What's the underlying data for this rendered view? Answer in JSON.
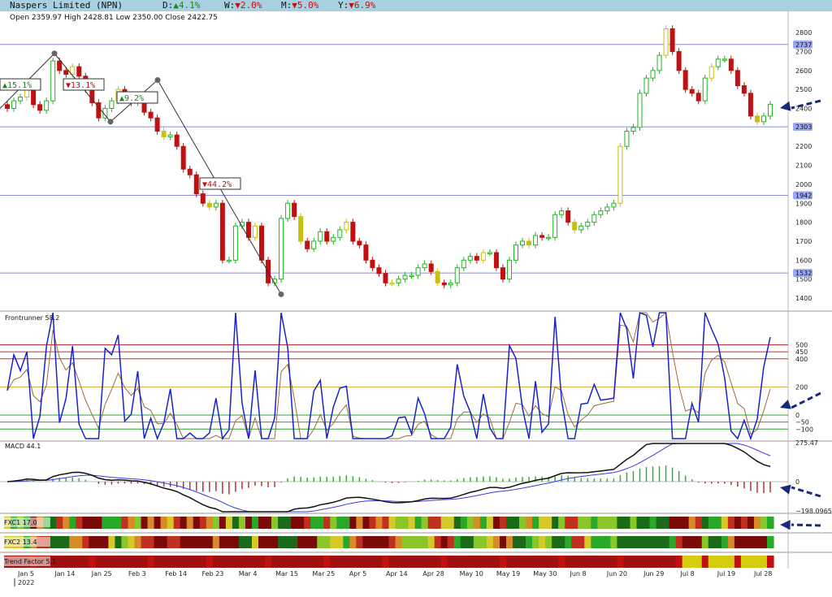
{
  "header": {
    "title": "Naspers Limited (NPN)",
    "d_label": "D:",
    "d_arrow": "▲",
    "d_value": "4.1%",
    "w_label": "W:",
    "w_arrow": "▼",
    "w_value": "2.0%",
    "m_label": "M:",
    "m_arrow": "▼",
    "m_value": "5.0%",
    "y_label": "Y:",
    "y_arrow": "▼",
    "y_value": "6.9%"
  },
  "ohlc": "Open 2359.97  High 2428.81  Low 2350.00  Close 2422.75",
  "chart_data": {
    "type": "candlestick",
    "price_ticks": [
      "2800",
      "2700",
      "2600",
      "2500",
      "2400",
      "2300",
      "2200",
      "2100",
      "2000",
      "1900",
      "1800",
      "1700",
      "1600",
      "1500",
      "1400"
    ],
    "levels": [
      "2737",
      "2303",
      "1942",
      "1532"
    ],
    "swing_labels": [
      "▲15.1%",
      "▼13.1%",
      "▲9.2%",
      "▼44.2%"
    ],
    "x_labels": [
      "Jan 5",
      "Jan 14",
      "Jan 25",
      "Feb 3",
      "Feb 14",
      "Feb 23",
      "Mar 4",
      "Mar 15",
      "Mar 25",
      "Apr 5",
      "Apr 14",
      "Apr 28",
      "May 10",
      "May 19",
      "May 30",
      "Jun 8",
      "Jun 20",
      "Jun 29",
      "Jul 8",
      "Jul 19",
      "Jul 28"
    ],
    "year_label": "2022",
    "closes": [
      2400,
      2440,
      2460,
      2500,
      2420,
      2390,
      2440,
      2650,
      2600,
      2580,
      2620,
      2570,
      2500,
      2430,
      2350,
      2400,
      2440,
      2500,
      2460,
      2430,
      2450,
      2380,
      2350,
      2280,
      2250,
      2260,
      2200,
      2080,
      2050,
      1950,
      1900,
      1880,
      1900,
      1600,
      1600,
      1780,
      1800,
      1720,
      1780,
      1600,
      1480,
      1500,
      1820,
      1900,
      1830,
      1700,
      1660,
      1700,
      1750,
      1700,
      1720,
      1760,
      1800,
      1700,
      1680,
      1600,
      1560,
      1530,
      1480,
      1480,
      1500,
      1520,
      1520,
      1560,
      1580,
      1540,
      1480,
      1470,
      1480,
      1560,
      1600,
      1620,
      1600,
      1640,
      1640,
      1560,
      1500,
      1600,
      1680,
      1700,
      1680,
      1730,
      1720,
      1720,
      1840,
      1860,
      1800,
      1760,
      1780,
      1800,
      1840,
      1860,
      1880,
      1900,
      2200,
      2280,
      2300,
      2480,
      2560,
      2600,
      2680,
      2820,
      2700,
      2600,
      2500,
      2480,
      2440,
      2560,
      2620,
      2660,
      2660,
      2600,
      2520,
      2480,
      2360,
      2330,
      2360,
      2422
    ],
    "frontrunner": {
      "label": "Frontrunner 58.2",
      "levels": [
        "500",
        "450",
        "400",
        "200",
        "0",
        "−50",
        "−100"
      ]
    },
    "macd": {
      "label": "MACD 44.1",
      "ticks": [
        "275.47",
        "0",
        "−198.0965"
      ]
    },
    "fxc1": {
      "label": "FXC1 17.0"
    },
    "fxc2": {
      "label": "FXC2 13.4"
    },
    "trend": {
      "label": "Trend Factor 5.1"
    }
  },
  "colors": {
    "up": "#22b322",
    "down": "#c01010",
    "neutral": "#c8c010",
    "line": "#1a22cc",
    "signal": "#9b6a3c"
  }
}
